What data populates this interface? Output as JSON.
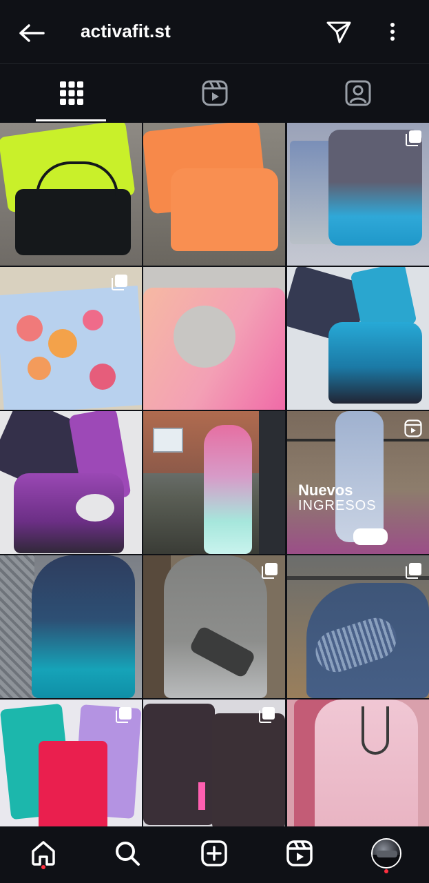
{
  "header": {
    "title": "activafit.st",
    "back_icon": "arrow-left-icon",
    "send_icon": "paper-plane-icon",
    "more_icon": "more-vertical-icon"
  },
  "tabs": [
    {
      "name": "posts",
      "icon": "grid-icon",
      "active": true
    },
    {
      "name": "reels",
      "icon": "reels-icon",
      "active": false
    },
    {
      "name": "tagged",
      "icon": "tagged-person-icon",
      "active": false
    }
  ],
  "grid_overlay": {
    "reel_title": "Nuevos",
    "reel_subtitle": "INGRESOS"
  },
  "bottom_nav": [
    {
      "name": "home",
      "icon": "home-icon",
      "notification": true
    },
    {
      "name": "search",
      "icon": "search-icon",
      "notification": false
    },
    {
      "name": "new-post",
      "icon": "plus-square-icon",
      "notification": false
    },
    {
      "name": "reels",
      "icon": "reels-icon",
      "notification": false
    },
    {
      "name": "profile",
      "icon": "avatar",
      "notification": true
    }
  ],
  "colors": {
    "background": "#0f1116",
    "notification": "#ff3040"
  }
}
